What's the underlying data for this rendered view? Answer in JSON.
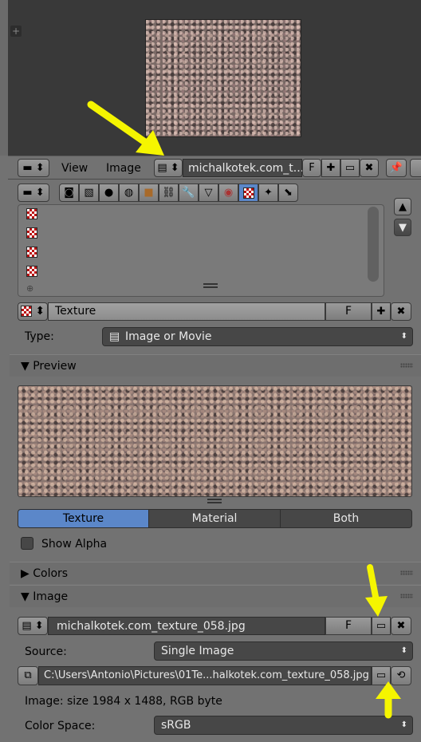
{
  "header": {
    "menu_view": "View",
    "menu_image": "Image",
    "image_name": "michalkotek.com_t...",
    "fake_user": "F"
  },
  "texture_block": {
    "name": "Texture",
    "fake_user": "F"
  },
  "type_row": {
    "label": "Type:",
    "value": "Image or Movie"
  },
  "preview_panel": {
    "title": "Preview",
    "tabs": [
      "Texture",
      "Material",
      "Both"
    ],
    "active_tab": "Texture",
    "show_alpha_label": "Show Alpha"
  },
  "colors_panel": {
    "title": "Colors"
  },
  "image_panel": {
    "title": "Image",
    "image_name": "michalkotek.com_texture_058.jpg",
    "fake_user": "F",
    "source_label": "Source:",
    "source_value": "Single Image",
    "filepath": "C:\\Users\\Antonio\\Pictures\\01Te...halkotek.com_texture_058.jpg",
    "info": "Image: size 1984 x 1488, RGB byte",
    "colorspace_label": "Color Space:",
    "colorspace_value": "sRGB"
  },
  "colors": {
    "active_tab": "#5b87c9",
    "annotation_arrow": "#f5f500"
  }
}
